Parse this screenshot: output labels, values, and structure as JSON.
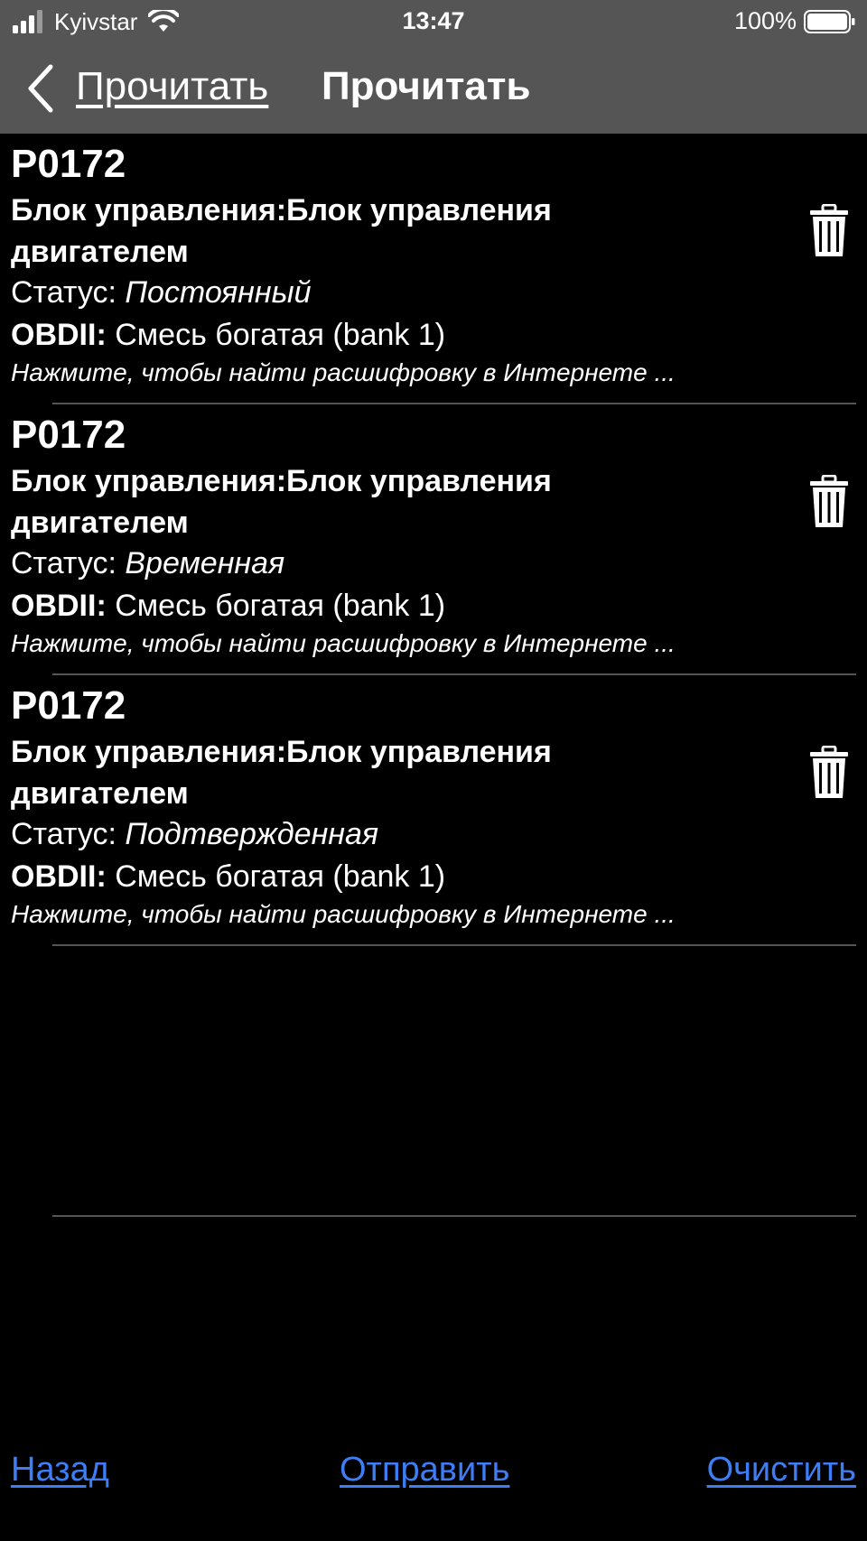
{
  "status_bar": {
    "carrier": "Kyivstar",
    "time": "13:47",
    "battery": "100%"
  },
  "nav": {
    "back_label": "Прочитать",
    "title": "Прочитать"
  },
  "codes": [
    {
      "code": "P0172",
      "module": "Блок управления:Блок управления двигателем",
      "status_label": "Статус: ",
      "status_value": "Постоянный",
      "obd_prefix": "OBDII:",
      "obd_desc": " Смесь богатая (bank 1)",
      "hint": "Нажмите, чтобы найти расшифровку в Интернете ..."
    },
    {
      "code": "P0172",
      "module": "Блок управления:Блок управления двигателем",
      "status_label": "Статус: ",
      "status_value": "Временная",
      "obd_prefix": "OBDII:",
      "obd_desc": " Смесь богатая (bank 1)",
      "hint": "Нажмите, чтобы найти расшифровку в Интернете ..."
    },
    {
      "code": "P0172",
      "module": "Блок управления:Блок управления двигателем",
      "status_label": "Статус: ",
      "status_value": "Подтвержденная",
      "obd_prefix": "OBDII:",
      "obd_desc": " Смесь богатая (bank 1)",
      "hint": "Нажмите, чтобы найти расшифровку в Интернете ..."
    }
  ],
  "footer": {
    "back": "Назад",
    "send": "Отправить",
    "clear": "Очистить"
  },
  "colors": {
    "background": "#000000",
    "bar": "#555555",
    "link": "#3d7df5",
    "separator": "#555555"
  },
  "icons": {
    "signal": "signal-icon",
    "wifi": "wifi-icon",
    "battery": "battery-icon",
    "back": "back-chevron-icon",
    "delete": "trash-icon"
  }
}
